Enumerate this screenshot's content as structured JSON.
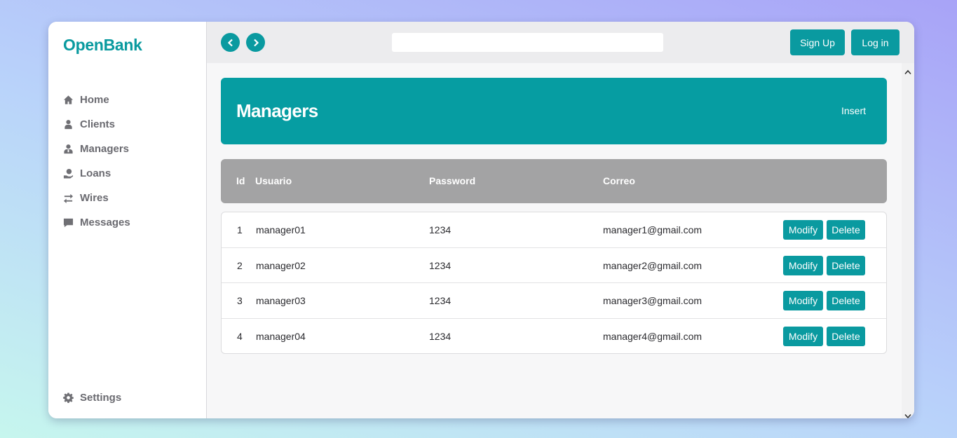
{
  "brand": {
    "name": "OpenBank"
  },
  "sidebar": {
    "items": [
      {
        "label": "Home",
        "icon": "home-icon"
      },
      {
        "label": "Clients",
        "icon": "person-icon"
      },
      {
        "label": "Managers",
        "icon": "manager-icon"
      },
      {
        "label": "Loans",
        "icon": "loan-hand-icon"
      },
      {
        "label": "Wires",
        "icon": "transfer-arrows-icon"
      },
      {
        "label": "Messages",
        "icon": "message-icon"
      }
    ],
    "settings": {
      "label": "Settings",
      "icon": "gear-icon"
    }
  },
  "topbar": {
    "back_icon": "chevron-left-icon",
    "forward_icon": "chevron-right-icon",
    "search": {
      "value": "",
      "placeholder": ""
    },
    "signup_label": "Sign Up",
    "login_label": "Log in"
  },
  "hero": {
    "title": "Managers",
    "insert_label": "Insert"
  },
  "table": {
    "headers": {
      "id": "Id",
      "user": "Usuario",
      "password": "Password",
      "email": "Correo"
    },
    "rows": [
      {
        "id": "1",
        "user": "manager01",
        "password": "1234",
        "email": "manager1@gmail.com",
        "modify": "Modify",
        "delete": "Delete"
      },
      {
        "id": "2",
        "user": "manager02",
        "password": "1234",
        "email": "manager2@gmail.com",
        "modify": "Modify",
        "delete": "Delete"
      },
      {
        "id": "3",
        "user": "manager03",
        "password": "1234",
        "email": "manager3@gmail.com",
        "modify": "Modify",
        "delete": "Delete"
      },
      {
        "id": "4",
        "user": "manager04",
        "password": "1234",
        "email": "manager4@gmail.com",
        "modify": "Modify",
        "delete": "Delete"
      }
    ]
  },
  "colors": {
    "accent": "#0a9aa0",
    "header_gray": "#a3a3a4"
  }
}
